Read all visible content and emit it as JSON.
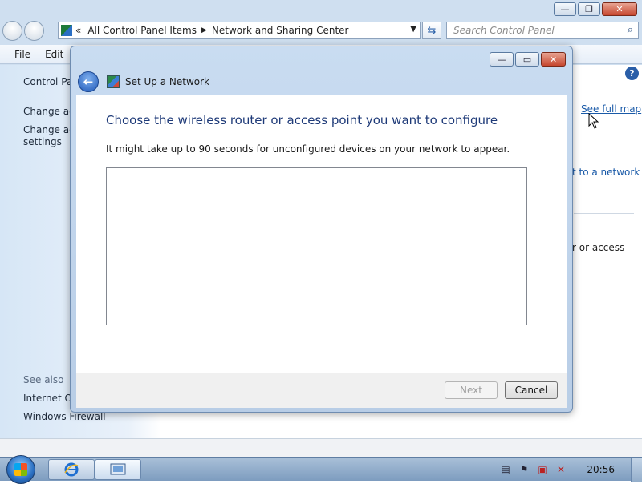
{
  "explorer": {
    "address_parts": [
      "All Control Panel Items",
      "Network and Sharing Center"
    ],
    "address_prefix": "«",
    "search_placeholder": "Search Control Panel",
    "menu": [
      "File",
      "Edit"
    ],
    "left_pane": {
      "home_link": "Control Pa",
      "link1": "Change ad",
      "link2_line1": "Change ad",
      "link2_line2": "settings",
      "see_also": "See also",
      "internet_options": "Internet Op",
      "windows_firewall": "Windows Firewall"
    },
    "right_content": {
      "see_full_map": "See full map",
      "connect_partial": "t to a network",
      "access_partial": "r or access"
    }
  },
  "dialog": {
    "title": "Set Up a Network",
    "heading": "Choose the wireless router or access point you want to configure",
    "description": "It might take up to 90 seconds for unconfigured devices on your network to appear.",
    "next_label": "Next",
    "cancel_label": "Cancel"
  },
  "taskbar": {
    "clock": "20:56"
  }
}
